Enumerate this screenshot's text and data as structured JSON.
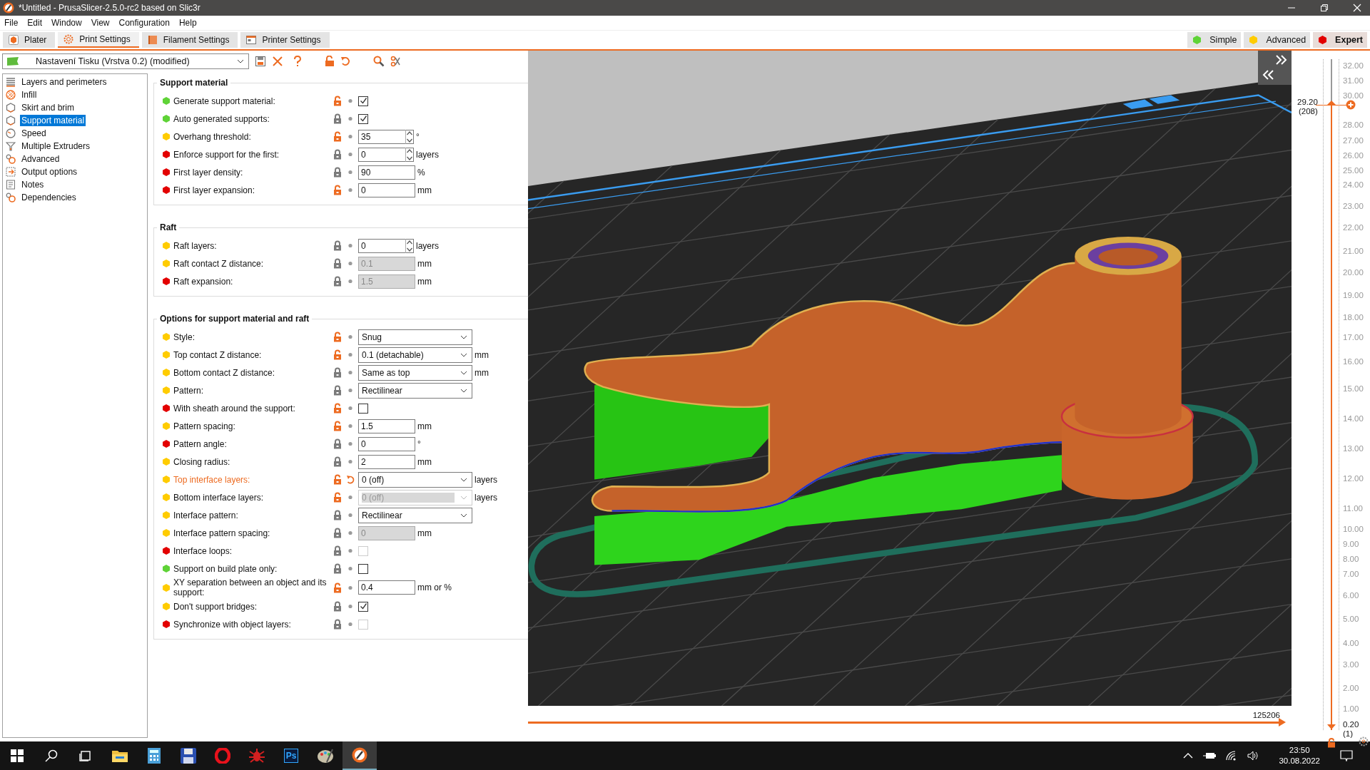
{
  "window": {
    "title": "*Untitled - PrusaSlicer-2.5.0-rc2 based on Slic3r"
  },
  "menu": [
    "File",
    "Edit",
    "Window",
    "View",
    "Configuration",
    "Help"
  ],
  "tabs": [
    {
      "label": "Plater",
      "selected": false
    },
    {
      "label": "Print Settings",
      "selected": true
    },
    {
      "label": "Filament Settings",
      "selected": false
    },
    {
      "label": "Printer Settings",
      "selected": false
    }
  ],
  "modes": [
    {
      "label": "Simple",
      "color": "#5fd337",
      "selected": false
    },
    {
      "label": "Advanced",
      "color": "#ffcc00",
      "selected": false
    },
    {
      "label": "Expert",
      "color": "#e30000",
      "selected": true
    }
  ],
  "preset": {
    "value": "Nastavení Tisku (Vrstva 0.2) (modified)"
  },
  "sidebar": {
    "items": [
      {
        "label": "Layers and perimeters",
        "selected": false
      },
      {
        "label": "Infill",
        "selected": false
      },
      {
        "label": "Skirt and brim",
        "selected": false
      },
      {
        "label": "Support material",
        "selected": true
      },
      {
        "label": "Speed",
        "selected": false
      },
      {
        "label": "Multiple Extruders",
        "selected": false
      },
      {
        "label": "Advanced",
        "selected": false
      },
      {
        "label": "Output options",
        "selected": false
      },
      {
        "label": "Notes",
        "selected": false
      },
      {
        "label": "Dependencies",
        "selected": false
      }
    ]
  },
  "groups": [
    {
      "title": "Support material",
      "rows": [
        {
          "label": "Generate support material:",
          "color": "#5fd337",
          "locked": false,
          "modified": false,
          "kind": "checkbox",
          "checked": true,
          "disabled": false
        },
        {
          "label": "Auto generated supports:",
          "color": "#5fd337",
          "locked": true,
          "modified": false,
          "kind": "checkbox",
          "checked": true,
          "disabled": false
        },
        {
          "label": "Overhang threshold:",
          "color": "#ffcc00",
          "locked": false,
          "modified": false,
          "kind": "spin",
          "value": "35",
          "unit": "°",
          "disabled": false
        },
        {
          "label": "Enforce support for the first:",
          "color": "#e30000",
          "locked": true,
          "modified": false,
          "kind": "spin",
          "value": "0",
          "unit": "layers",
          "disabled": false
        },
        {
          "label": "First layer density:",
          "color": "#e30000",
          "locked": true,
          "modified": false,
          "kind": "text",
          "value": "90",
          "unit": "%",
          "disabled": false
        },
        {
          "label": "First layer expansion:",
          "color": "#e30000",
          "locked": false,
          "modified": false,
          "kind": "text",
          "value": "0",
          "unit": "mm",
          "disabled": false
        }
      ]
    },
    {
      "title": "Raft",
      "rows": [
        {
          "label": "Raft layers:",
          "color": "#ffcc00",
          "locked": true,
          "modified": false,
          "kind": "spin",
          "value": "0",
          "unit": "layers",
          "disabled": false
        },
        {
          "label": "Raft contact Z distance:",
          "color": "#ffcc00",
          "locked": true,
          "modified": false,
          "kind": "text",
          "value": "0.1",
          "unit": "mm",
          "disabled": true
        },
        {
          "label": "Raft expansion:",
          "color": "#e30000",
          "locked": true,
          "modified": false,
          "kind": "text",
          "value": "1.5",
          "unit": "mm",
          "disabled": true
        }
      ]
    },
    {
      "title": "Options for support material and raft",
      "rows": [
        {
          "label": "Style:",
          "color": "#ffcc00",
          "locked": false,
          "modified": false,
          "kind": "combo",
          "value": "Snug",
          "disabled": false
        },
        {
          "label": "Top contact Z distance:",
          "color": "#ffcc00",
          "locked": false,
          "modified": false,
          "kind": "combo",
          "value": "0.1 (detachable)",
          "unit": "mm",
          "disabled": false
        },
        {
          "label": "Bottom contact Z distance:",
          "color": "#ffcc00",
          "locked": true,
          "modified": false,
          "kind": "combo",
          "value": "Same as top",
          "unit": "mm",
          "disabled": false
        },
        {
          "label": "Pattern:",
          "color": "#ffcc00",
          "locked": true,
          "modified": false,
          "kind": "combo",
          "value": "Rectilinear",
          "disabled": false
        },
        {
          "label": "With sheath around the support:",
          "color": "#e30000",
          "locked": false,
          "modified": false,
          "kind": "checkbox",
          "checked": false,
          "disabled": false
        },
        {
          "label": "Pattern spacing:",
          "color": "#ffcc00",
          "locked": false,
          "modified": false,
          "kind": "text",
          "value": "1.5",
          "unit": "mm",
          "disabled": false
        },
        {
          "label": "Pattern angle:",
          "color": "#e30000",
          "locked": true,
          "modified": false,
          "kind": "text",
          "value": "0",
          "unit": "°",
          "disabled": false
        },
        {
          "label": "Closing radius:",
          "color": "#ffcc00",
          "locked": true,
          "modified": false,
          "kind": "text",
          "value": "2",
          "unit": "mm",
          "disabled": false
        },
        {
          "label": "Top interface layers:",
          "color": "#ffcc00",
          "locked": false,
          "modified": true,
          "kind": "combo",
          "value": "0 (off)",
          "unit": "layers",
          "disabled": false
        },
        {
          "label": "Bottom interface layers:",
          "color": "#ffcc00",
          "locked": false,
          "modified": false,
          "kind": "combo",
          "value": "0 (off)",
          "unit": "layers",
          "disabled": true
        },
        {
          "label": "Interface pattern:",
          "color": "#ffcc00",
          "locked": true,
          "modified": false,
          "kind": "combo",
          "value": "Rectilinear",
          "disabled": false
        },
        {
          "label": "Interface pattern spacing:",
          "color": "#ffcc00",
          "locked": true,
          "modified": false,
          "kind": "text",
          "value": "0",
          "unit": "mm",
          "disabled": true
        },
        {
          "label": "Interface loops:",
          "color": "#e30000",
          "locked": true,
          "modified": false,
          "kind": "checkbox",
          "checked": false,
          "disabled": true
        },
        {
          "label": "Support on build plate only:",
          "color": "#5fd337",
          "locked": true,
          "modified": false,
          "kind": "checkbox",
          "checked": false,
          "disabled": false
        },
        {
          "label": "XY separation between an object and its support:",
          "color": "#ffcc00",
          "locked": false,
          "modified": false,
          "kind": "text",
          "value": "0.4",
          "unit": "mm or %",
          "disabled": false
        },
        {
          "label": "Don't support bridges:",
          "color": "#ffcc00",
          "locked": true,
          "modified": false,
          "kind": "checkbox",
          "checked": true,
          "disabled": false
        },
        {
          "label": "Synchronize with object layers:",
          "color": "#e30000",
          "locked": true,
          "modified": false,
          "kind": "checkbox",
          "checked": false,
          "disabled": true
        }
      ]
    }
  ],
  "layer_slider": {
    "ticks": [
      "32.00",
      "31.00",
      "30.00",
      "28.00",
      "27.00",
      "26.00",
      "25.00",
      "24.00",
      "23.00",
      "22.00",
      "21.00",
      "20.00",
      "19.00",
      "18.00",
      "17.00",
      "16.00",
      "15.00",
      "14.00",
      "13.00",
      "12.00",
      "11.00",
      "10.00",
      "9.00",
      "8.00",
      "7.00",
      "6.00",
      "5.00",
      "4.00",
      "3.00",
      "2.00",
      "1.00"
    ],
    "thumbs": [
      {
        "value": "29.20",
        "layer": "(208)",
        "level": 0.932
      },
      {
        "value": "0.20",
        "layer": "(1)",
        "level": 0
      }
    ]
  },
  "move_slider": {
    "value": "125206",
    "level": 1
  },
  "taskbar": {
    "app_label": "Ps",
    "time": "23:50",
    "date": "30.08.2022"
  }
}
